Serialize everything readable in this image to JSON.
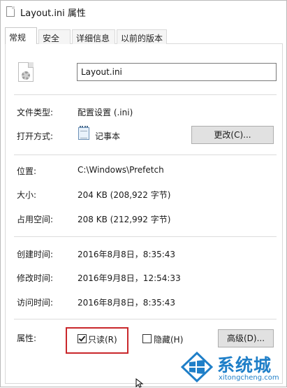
{
  "window": {
    "title": "Layout.ini 属性"
  },
  "tabs": [
    {
      "label": "常规",
      "active": true
    },
    {
      "label": "安全",
      "active": false
    },
    {
      "label": "详细信息",
      "active": false
    },
    {
      "label": "以前的版本",
      "active": false
    }
  ],
  "general": {
    "file_name": "Layout.ini",
    "file_type_label": "文件类型:",
    "file_type_value": "配置设置 (.ini)",
    "open_with_label": "打开方式:",
    "open_with_value": "记事本",
    "change_button": "更改(C)...",
    "location_label": "位置:",
    "location_value": "C:\\Windows\\Prefetch",
    "size_label": "大小:",
    "size_value": "204 KB (208,922 字节)",
    "size_on_disk_label": "占用空间:",
    "size_on_disk_value": "208 KB (212,992 字节)",
    "created_label": "创建时间:",
    "created_value": "2016年8月8日，8:35:43",
    "modified_label": "修改时间:",
    "modified_value": "2016年9月8日，12:54:33",
    "accessed_label": "访问时间:",
    "accessed_value": "2016年8月8日，8:35:43",
    "attributes_label": "属性:",
    "readonly_label": "只读(R)",
    "readonly_checked": true,
    "hidden_label": "隐藏(H)",
    "hidden_checked": false,
    "advanced_button": "高级(D)..."
  },
  "watermark": {
    "text": "系统城",
    "sub": "xitongcheng.com"
  },
  "colors": {
    "highlight": "#c9272b",
    "watermark_blue": "#1f7fc8"
  }
}
